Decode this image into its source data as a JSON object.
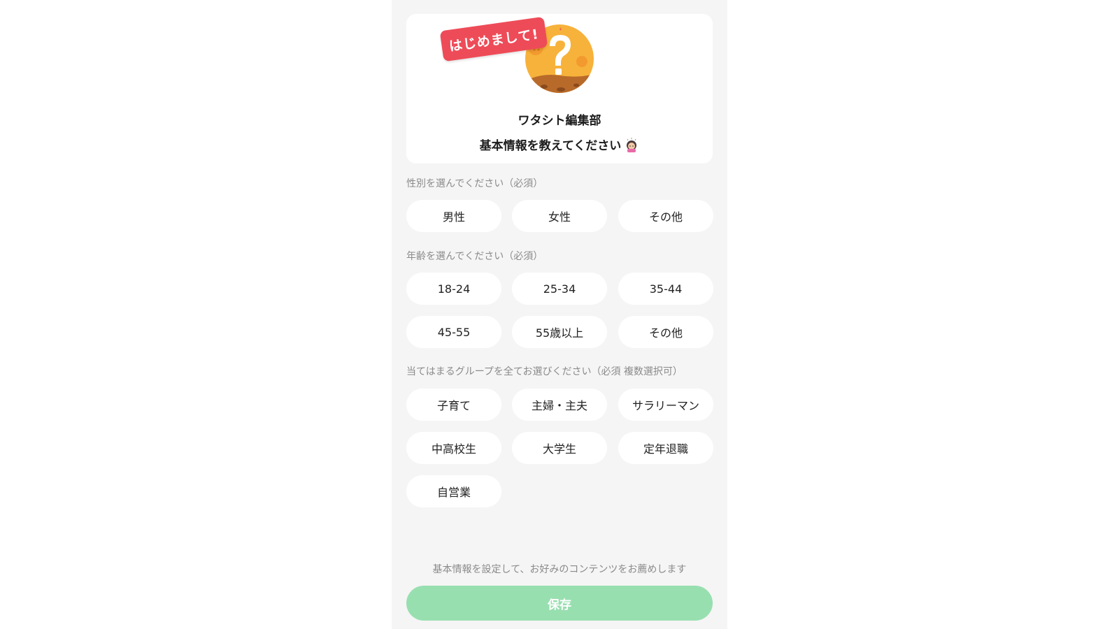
{
  "intro": {
    "badge": "はじめまして!",
    "title": "ワタシト編集部",
    "subtitle": "基本情報を教えてください",
    "subtitle_icon": "girl-emoji-icon"
  },
  "gender": {
    "label": "性別を選んでください（必須）",
    "options": [
      "男性",
      "女性",
      "その他"
    ]
  },
  "age": {
    "label": "年齢を選んでください（必須）",
    "options": [
      "18-24",
      "25-34",
      "35-44",
      "45-55",
      "55歳以上",
      "その他"
    ]
  },
  "groups": {
    "label": "当てはまるグループを全てお選びください（必須 複数選択可）",
    "options": [
      "子育て",
      "主婦・主夫",
      "サラリーマン",
      "中高校生",
      "大学生",
      "定年退職",
      "自営業"
    ]
  },
  "footer": {
    "note": "基本情報を設定して、お好みのコンテンツをお薦めします",
    "save_label": "保存"
  },
  "colors": {
    "badge": "#ee4b58",
    "save_button": "#98dfb0",
    "avatar": "#f7b23b",
    "background": "#f5f5f5"
  }
}
